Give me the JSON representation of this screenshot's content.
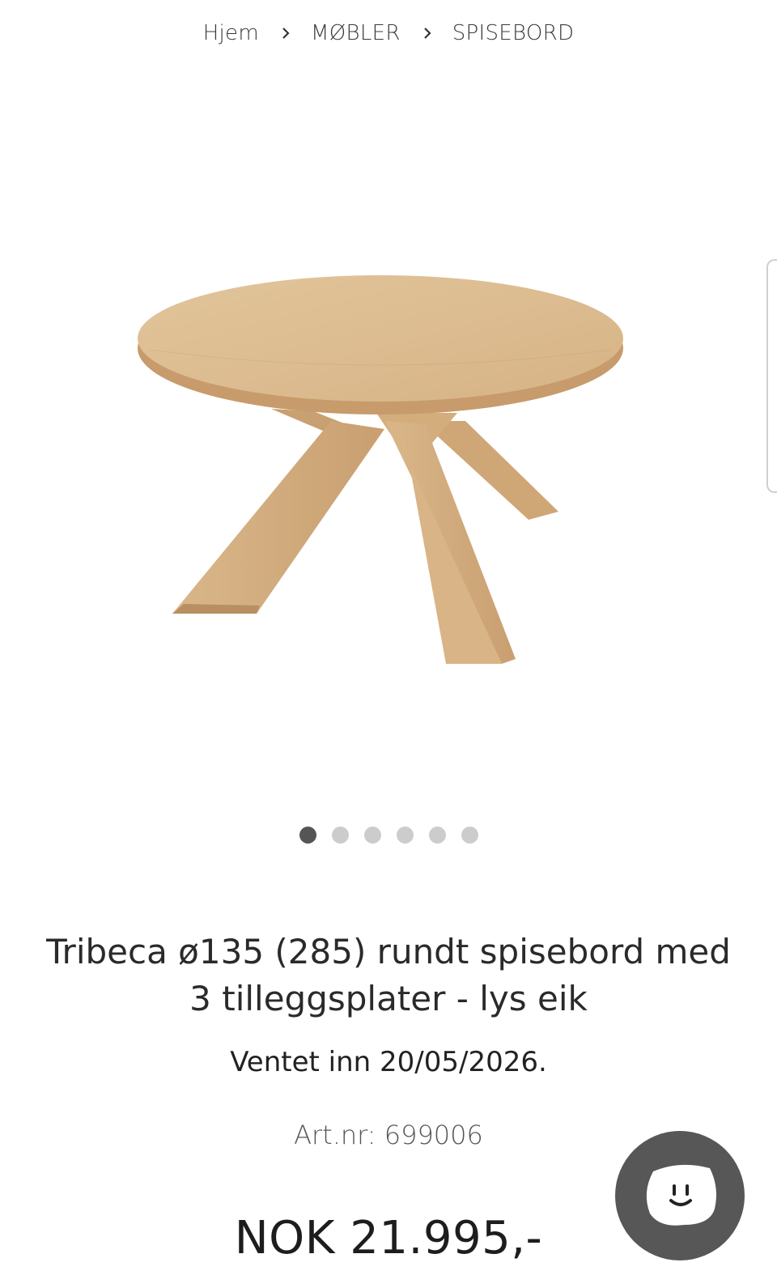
{
  "breadcrumb": {
    "items": [
      "Hjem",
      "MØBLER",
      "SPISEBORD"
    ]
  },
  "gallery": {
    "image_alt": "Tribeca ø135 rundt spisebord - lys eik",
    "slide_count": 6,
    "active_slide": 1
  },
  "product": {
    "title": "Tribeca ø135 (285) rundt spisebord med 3 tilleggsplater - lys eik",
    "availability": "Ventet inn 20/05/2026.",
    "art_nr": "Art.nr: 699006",
    "price": "NOK 21.995,-"
  },
  "icons": {
    "separator": "chevron-right-icon",
    "chat": "chat-smiley-icon"
  },
  "colors": {
    "wood_top": "#dfc195",
    "wood_edge": "#c9a071",
    "dot_active": "#555555",
    "dot_inactive": "#cccccc",
    "chat_bg": "#575757"
  }
}
